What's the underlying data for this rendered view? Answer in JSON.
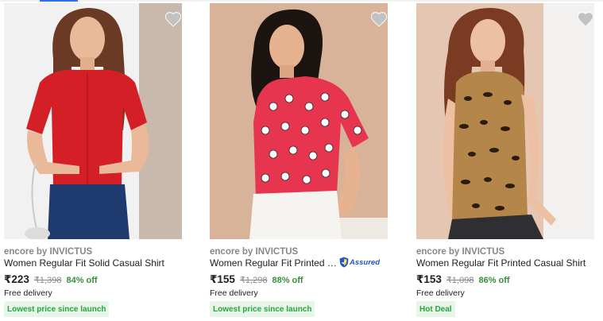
{
  "colors": {
    "accent": "#2874f0",
    "discount": "#388e3c",
    "badge_text": "#26a541",
    "badge_bg": "#e8f5e9",
    "muted": "#878787",
    "assured": "#2455c3"
  },
  "products": [
    {
      "brand": "encore by INVICTUS",
      "title": "Women Regular Fit Solid Casual Shirt",
      "price": "₹223",
      "mrp": "₹1,398",
      "discount": "84% off",
      "delivery": "Free delivery",
      "badge": "Lowest price since launch",
      "assured": false,
      "image_icon": "product-photo-red-solid-shirt",
      "wishlist_icon": "heart-icon"
    },
    {
      "brand": "encore by INVICTUS",
      "title": "Women Regular Fit Printed Casual Shirt",
      "price": "₹155",
      "mrp": "₹1,298",
      "discount": "88% off",
      "delivery": "Free delivery",
      "badge": "Lowest price since launch",
      "assured": true,
      "assured_label": "Assured",
      "image_icon": "product-photo-red-polka-dot-shirt",
      "wishlist_icon": "heart-icon"
    },
    {
      "brand": "encore by INVICTUS",
      "title": "Women Regular Fit Printed Casual Shirt",
      "price": "₹153",
      "mrp": "₹1,098",
      "discount": "86% off",
      "delivery": "Free delivery",
      "badge": "Hot Deal",
      "assured": false,
      "image_icon": "product-photo-leopard-print-shirt",
      "wishlist_icon": "heart-icon"
    }
  ]
}
